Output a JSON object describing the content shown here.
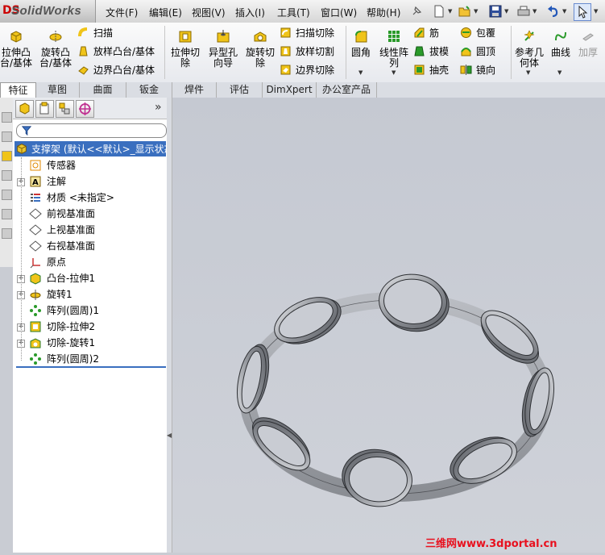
{
  "app": {
    "logo_text": "SolidWorks",
    "logo_mark": "DS"
  },
  "menu": [
    "文件(F)",
    "编辑(E)",
    "视图(V)",
    "插入(I)",
    "工具(T)",
    "窗口(W)",
    "帮助(H)"
  ],
  "commands": {
    "extrude_boss": [
      "拉伸凸",
      "台/基体"
    ],
    "revolve_boss": [
      "旋转凸",
      "台/基体"
    ],
    "sweep": "扫描",
    "loft_boss": "放样凸台/基体",
    "boundary_boss": "边界凸台/基体",
    "extrude_cut": [
      "拉伸切",
      "除"
    ],
    "hole_wizard": [
      "异型孔",
      "向导"
    ],
    "revolve_cut": [
      "旋转切",
      "除"
    ],
    "sweep_cut": "扫描切除",
    "loft_cut": "放样切割",
    "boundary_cut": "边界切除",
    "fillet": "圆角",
    "linear_pattern": [
      "线性阵",
      "列"
    ],
    "rib": "筋",
    "draft": "拔模",
    "shell": "抽壳",
    "wrap": "包覆",
    "dome": "圆顶",
    "mirror": "镜向",
    "ref_geometry": [
      "参考几",
      "何体"
    ],
    "curves": "曲线",
    "thicken": "加厚"
  },
  "tabs": [
    "特征",
    "草图",
    "曲面",
    "钣金",
    "焊件",
    "评估",
    "DimXpert",
    "办公室产品"
  ],
  "active_tab": "特征",
  "tree": {
    "root": "支撑架 (默认<<默认>_显示状态",
    "items": [
      {
        "label": "传感器",
        "icon": "sensor-icon",
        "expandable": false
      },
      {
        "label": "注解",
        "icon": "annotation-icon",
        "expandable": true
      },
      {
        "label": "材质 <未指定>",
        "icon": "material-icon",
        "expandable": false
      },
      {
        "label": "前视基准面",
        "icon": "plane-icon",
        "expandable": false
      },
      {
        "label": "上视基准面",
        "icon": "plane-icon",
        "expandable": false
      },
      {
        "label": "右视基准面",
        "icon": "plane-icon",
        "expandable": false
      },
      {
        "label": "原点",
        "icon": "origin-icon",
        "expandable": false
      },
      {
        "label": "凸台-拉伸1",
        "icon": "extrude-icon",
        "expandable": true
      },
      {
        "label": "旋转1",
        "icon": "revolve-icon",
        "expandable": true
      },
      {
        "label": "阵列(圆周)1",
        "icon": "circular-pattern-icon",
        "expandable": false
      },
      {
        "label": "切除-拉伸2",
        "icon": "cut-extrude-icon",
        "expandable": true
      },
      {
        "label": "切除-旋转1",
        "icon": "cut-revolve-icon",
        "expandable": true
      },
      {
        "label": "阵列(圆周)2",
        "icon": "circular-pattern-icon",
        "expandable": false
      }
    ]
  },
  "fm_collapse": "»",
  "watermark": "三维网www.3dportal.cn",
  "colors": {
    "selection": "#3a6fbf",
    "viewport": "#c9ccd3",
    "watermark": "#e8101e",
    "model": "#8a8d93"
  }
}
